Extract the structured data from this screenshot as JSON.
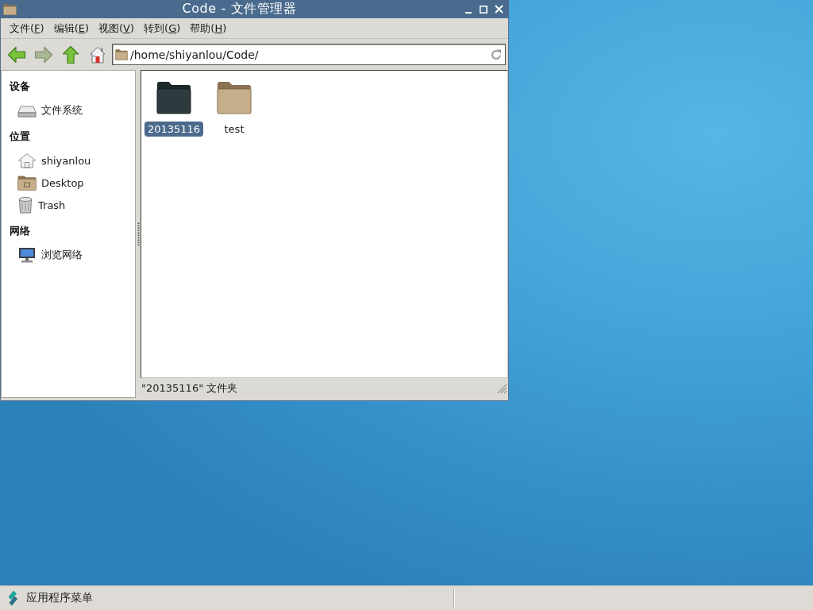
{
  "window": {
    "title": "Code - 文件管理器"
  },
  "menu": [
    {
      "label": "文件(",
      "key": "F",
      "end": ")"
    },
    {
      "label": "编辑(",
      "key": "E",
      "end": ")"
    },
    {
      "label": "视图(",
      "key": "V",
      "end": ")"
    },
    {
      "label": "转到(",
      "key": "G",
      "end": ")"
    },
    {
      "label": "帮助(",
      "key": "H",
      "end": ")"
    }
  ],
  "toolbar": [
    {
      "kind": "back",
      "disabled": false
    },
    {
      "kind": "forward",
      "disabled": true
    },
    {
      "kind": "up",
      "disabled": false
    },
    {
      "kind": "home",
      "disabled": false
    }
  ],
  "location": {
    "value": "/home/shiyanlou/Code/"
  },
  "sidebar": {
    "sections": [
      {
        "title": "设备",
        "items": [
          {
            "label": "文件系统",
            "kind": "drive",
            "selected": false
          }
        ]
      },
      {
        "title": "位置",
        "items": [
          {
            "label": "shiyanlou",
            "kind": "home",
            "selected": false
          },
          {
            "label": "Desktop",
            "kind": "desktop",
            "selected": false
          },
          {
            "label": "Trash",
            "kind": "trash",
            "selected": false
          }
        ]
      },
      {
        "title": "网络",
        "items": [
          {
            "label": "浏览网络",
            "kind": "network",
            "selected": false
          }
        ]
      }
    ]
  },
  "files": [
    {
      "name": "20135116",
      "selected": true
    },
    {
      "name": "test",
      "selected": false
    }
  ],
  "status_bar": {
    "text": "\"20135116\" 文件夹"
  },
  "taskbar": {
    "menu_label": "应用程序菜单"
  }
}
